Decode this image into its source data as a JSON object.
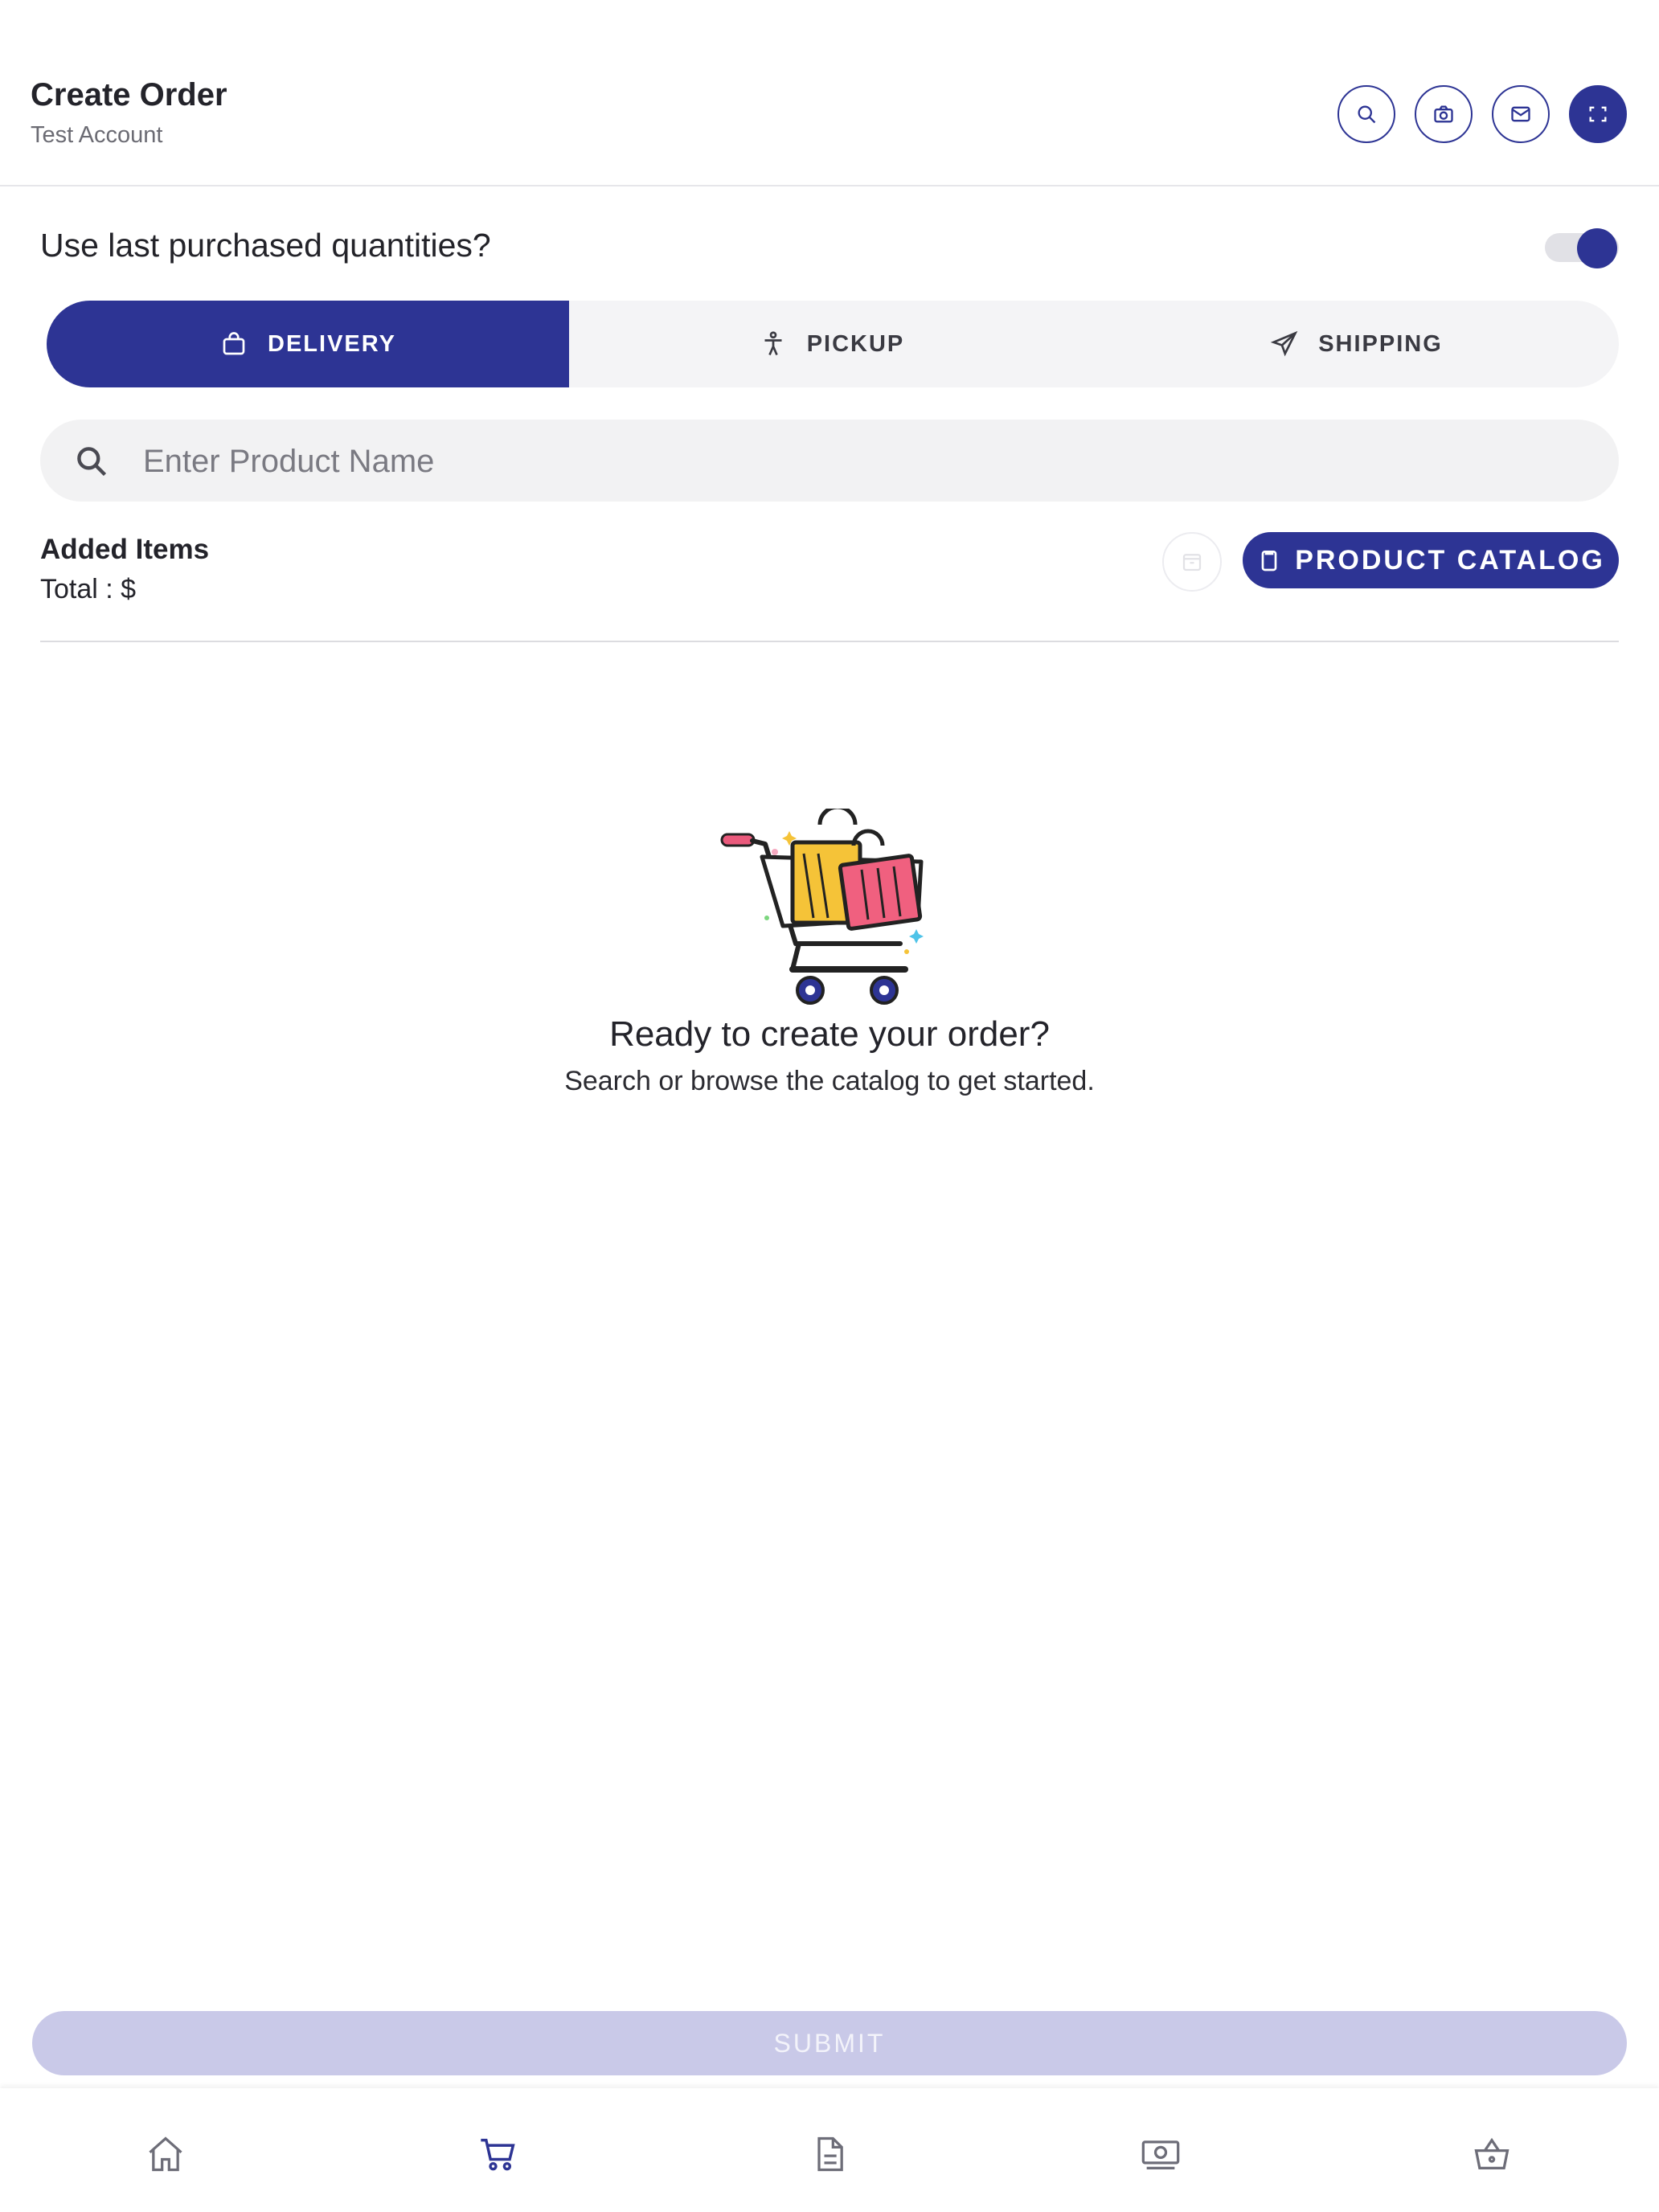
{
  "header": {
    "title": "Create Order",
    "subtitle": "Test Account",
    "actions": [
      "search-icon",
      "camera-icon",
      "mail-icon",
      "scan-icon"
    ]
  },
  "last_purchased": {
    "label": "Use last purchased quantities?",
    "enabled": true
  },
  "tabs": [
    {
      "label": "DELIVERY",
      "icon": "bag-icon",
      "active": true
    },
    {
      "label": "PICKUP",
      "icon": "person-icon",
      "active": false
    },
    {
      "label": "SHIPPING",
      "icon": "send-icon",
      "active": false
    }
  ],
  "search": {
    "placeholder": "Enter Product Name",
    "value": ""
  },
  "items": {
    "title": "Added Items",
    "total": "Total : $",
    "catalog_button": "PRODUCT CATALOG"
  },
  "empty_state": {
    "title": "Ready to create your order?",
    "subtitle": "Search or browse the catalog to get started."
  },
  "submit_label": "SUBMIT",
  "bottom_nav": [
    "home-icon",
    "cart-icon",
    "document-icon",
    "cash-icon",
    "basket-icon"
  ],
  "colors": {
    "accent": "#2d3494",
    "submit_disabled": "#c9c9e8"
  }
}
